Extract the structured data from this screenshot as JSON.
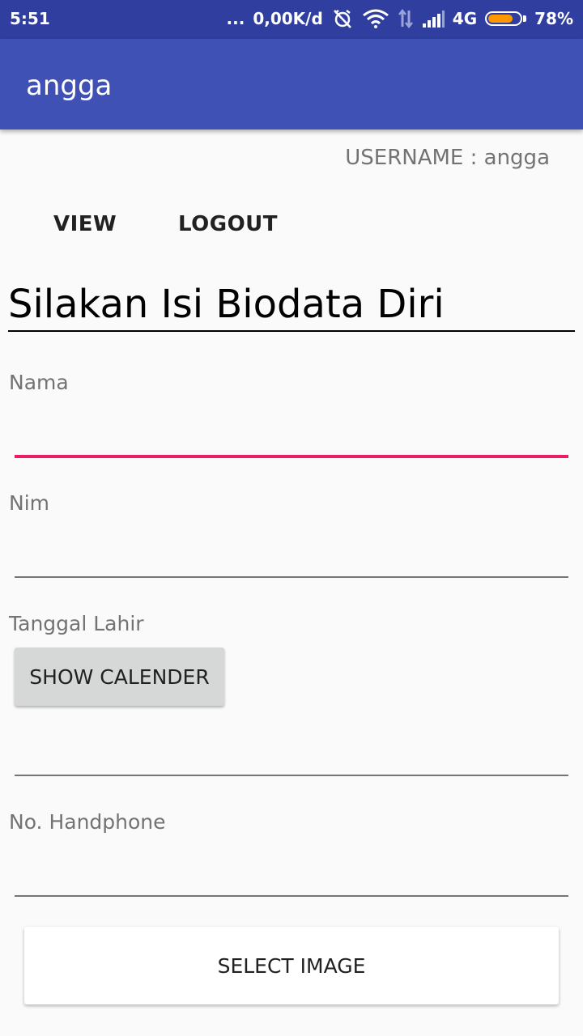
{
  "status_bar": {
    "time": "5:51",
    "dots": "...",
    "net_speed": "0,00K/d",
    "network_type": "4G",
    "battery_percent": "78%",
    "battery_level": 0.78,
    "battery_fill_color": "#ff9800",
    "icons": [
      "alarm-off-icon",
      "wifi-icon",
      "data-arrows-icon",
      "signal-icon",
      "battery-icon"
    ]
  },
  "app_bar": {
    "title": "angga",
    "color": "#3f51b5"
  },
  "user": {
    "username_text": "USERNAME : angga"
  },
  "actions": {
    "view_label": "VIEW",
    "logout_label": "LOGOUT"
  },
  "form": {
    "heading": "Silakan Isi Biodata Diri",
    "nama_label": "Nama",
    "nama_value": "",
    "nim_label": "Nim",
    "nim_value": "",
    "tanggal_label": "Tanggal Lahir",
    "show_calendar_label": "SHOW CALENDER",
    "tanggal_value": "",
    "hp_label": "No. Handphone",
    "hp_value": "",
    "select_image_label": "SELECT IMAGE",
    "accent_color": "#e91e63"
  }
}
